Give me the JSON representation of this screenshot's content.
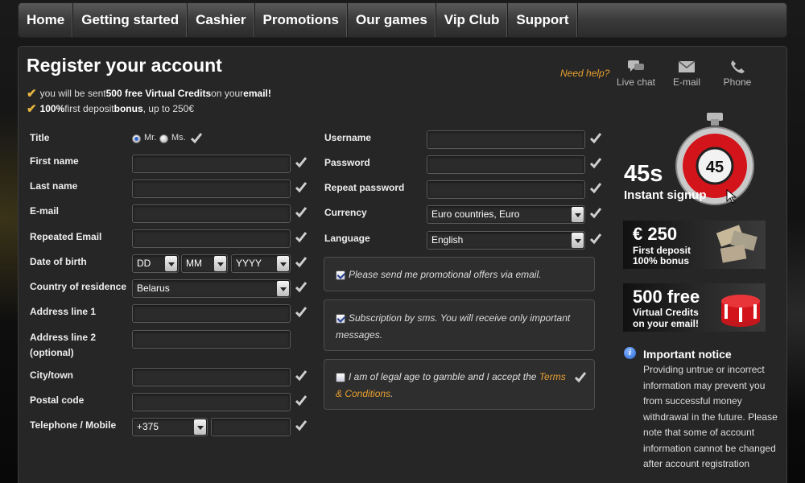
{
  "nav": [
    "Home",
    "Getting started",
    "Cashier",
    "Promotions",
    "Our games",
    "Vip Club",
    "Support"
  ],
  "title": "Register your account",
  "promos": [
    {
      "pre": "you will be sent ",
      "b1": "500 free Virtual Credits",
      "mid": " on your ",
      "b2": "email!",
      "post": ""
    },
    {
      "pre": "",
      "b1": "100%",
      "mid": " first deposit ",
      "b2": "bonus",
      "post": ", up to 250€"
    }
  ],
  "help": {
    "label": "Need help?",
    "live_chat": "Live chat",
    "email": "E-mail",
    "phone": "Phone"
  },
  "left": {
    "title_label": "Title",
    "mr": "Mr.",
    "ms": "Ms.",
    "first_name": "First name",
    "last_name": "Last name",
    "email": "E-mail",
    "repeated_email": "Repeated Email",
    "dob": "Date of birth",
    "dob_day": "DD",
    "dob_month": "MM",
    "dob_year": "YYYY",
    "country": "Country of residence",
    "country_value": "Belarus",
    "address1": "Address line 1",
    "address2_a": "Address line 2",
    "address2_b": "(optional)",
    "city": "City/town",
    "postal": "Postal code",
    "phone": "Telephone / Mobile",
    "phone_code": "+375"
  },
  "right": {
    "username": "Username",
    "password": "Password",
    "repeat_password": "Repeat password",
    "currency": "Currency",
    "currency_value": "Euro countries, Euro",
    "language": "Language",
    "language_value": "English",
    "opt_email": "Please send me promotional offers via email.",
    "opt_sms_a": "Subscription by sms. You will receive only important",
    "opt_sms_b": "messages.",
    "terms_a": "I am of legal age to gamble and I accept the ",
    "terms_link_a": "Terms",
    "terms_link_b": "& Conditions",
    "terms_b": "."
  },
  "side": {
    "timer_value": "45",
    "timer_big": "45s",
    "timer_sub": "Instant signup",
    "deposit_big": "€ 250",
    "deposit_l1": "First deposit",
    "deposit_l2": "100% bonus",
    "credits_big": "500 free",
    "credits_l1": "Virtual Credits",
    "credits_l2": "on your email!",
    "notice_title": "Important notice",
    "notice_body": "Providing untrue or incorrect information may prevent you from successful money withdrawal in the future. Please note that some of account information cannot be changed after account registration"
  },
  "colors": {
    "accent": "#e8a130",
    "tick": "#e8b640",
    "timer_red": "#d4141b"
  }
}
